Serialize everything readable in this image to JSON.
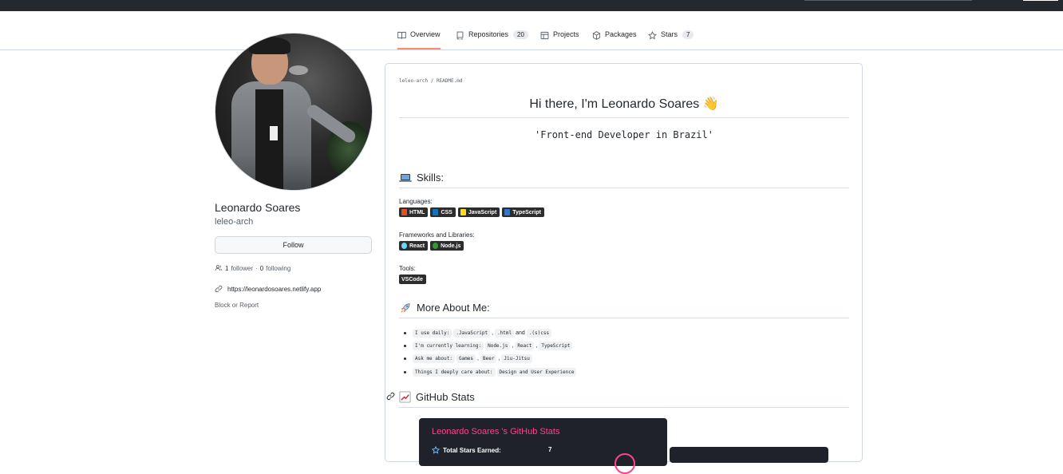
{
  "colors": {
    "topbar": "#24292f",
    "active_tab_underline": "#fd8c73",
    "stats_card_bg": "#1f222a",
    "stats_title": "#fe428e"
  },
  "tabs": [
    {
      "label": "Overview",
      "icon": "book-icon",
      "active": true
    },
    {
      "label": "Repositories",
      "icon": "repo-icon",
      "count": "20"
    },
    {
      "label": "Projects",
      "icon": "table-icon"
    },
    {
      "label": "Packages",
      "icon": "package-icon"
    },
    {
      "label": "Stars",
      "icon": "star-icon",
      "count": "7"
    }
  ],
  "profile": {
    "name": "Leonardo Soares",
    "login": "leleo-arch",
    "follow_label": "Follow",
    "followers_count": "1",
    "followers_label": "follower",
    "separator": "·",
    "following_count": "0",
    "following_label": "following",
    "website": "https://leonardosoares.netlify.app",
    "block_label": "Block or Report"
  },
  "readme": {
    "path": "leleo-arch / README.md",
    "title": "Hi there, I'm Leonardo Soares 👋",
    "subtitle": "'Front-end Developer in Brazil'",
    "skills_heading": "Skills:",
    "languages_label": "Languages:",
    "languages": [
      {
        "label": "HTML",
        "color": "#e34f26"
      },
      {
        "label": "CSS",
        "color": "#1572b6"
      },
      {
        "label": "JavaScript",
        "color": "#f7df1e"
      },
      {
        "label": "TypeScript",
        "color": "#3178c6"
      }
    ],
    "frameworks_label": "Frameworks and Libraries:",
    "frameworks": [
      {
        "label": "React",
        "color": "#61dafb"
      },
      {
        "label": "Node.js",
        "color": "#339933"
      }
    ],
    "tools_label": "Tools:",
    "tools": [
      {
        "label": "VSCode"
      }
    ],
    "about_heading": "More About Me:",
    "about": [
      {
        "lead": "I use daily:",
        "items": [
          ".JavaScript",
          ".html"
        ],
        "joiner": "and",
        "last": ".(s)css"
      },
      {
        "lead": "I'm currently learning:",
        "items": [
          "Node.js",
          "React",
          "TypeScript"
        ]
      },
      {
        "lead": "Ask me about:",
        "items": [
          "Games",
          "Beer",
          "Jiu-Jitsu"
        ]
      },
      {
        "lead": "Things I deeply care about:",
        "items": [
          "Design and User Experience"
        ]
      }
    ],
    "stats_heading": "GitHub Stats",
    "stats_card": {
      "title": "Leonardo Soares 's GitHub Stats",
      "row_label": "Total Stars Earned:",
      "row_value": "7"
    }
  }
}
